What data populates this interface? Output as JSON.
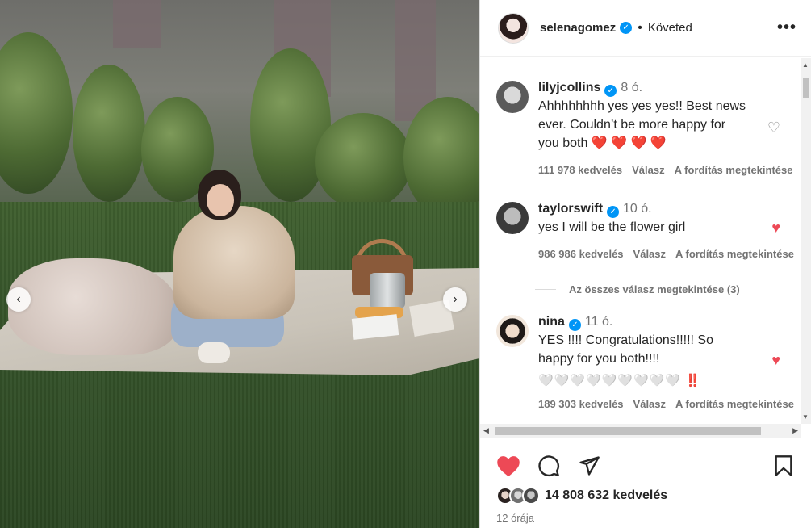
{
  "header": {
    "username": "selenagomez",
    "follow_label": "Követed",
    "more_label": "•••"
  },
  "comments": [
    {
      "username": "lilyjcollins",
      "time": "8 ó.",
      "text": "Ahhhhhhhh yes yes yes!! Best news ever. Couldn’t be more happy for you both ❤️ ❤️ ❤️ ❤️",
      "likes": "111 978 kedvelés",
      "reply": "Válasz",
      "translate": "A fordítás megtekintése",
      "liked": false
    },
    {
      "username": "taylorswift",
      "time": "10 ó.",
      "text": "yes I will be the flower girl",
      "likes": "986 986 kedvelés",
      "reply": "Válasz",
      "translate": "A fordítás megtekintése",
      "liked": true
    },
    {
      "username": "nina",
      "time": "11 ó.",
      "text": "YES !!!! Congratulations!!!!! So happy for you both!!!!",
      "emoji_line": "🤍🤍🤍🤍🤍🤍🤍🤍🤍 ‼️",
      "likes": "189 303 kedvelés",
      "reply": "Válasz",
      "translate": "A fordítás megtekintése",
      "liked": true
    }
  ],
  "view_replies": "Az összes válasz megtekintése (3)",
  "post": {
    "likes": "14 808 632 kedvelés",
    "time_ago": "12 órája"
  },
  "colors": {
    "like_red": "#ed4956",
    "verified_blue": "#0095f6",
    "muted": "#737373"
  },
  "icons": {
    "prev": "chevron-left-icon",
    "next": "chevron-right-icon",
    "like": "heart-icon",
    "comment": "comment-icon",
    "share": "send-icon",
    "save": "bookmark-icon"
  }
}
